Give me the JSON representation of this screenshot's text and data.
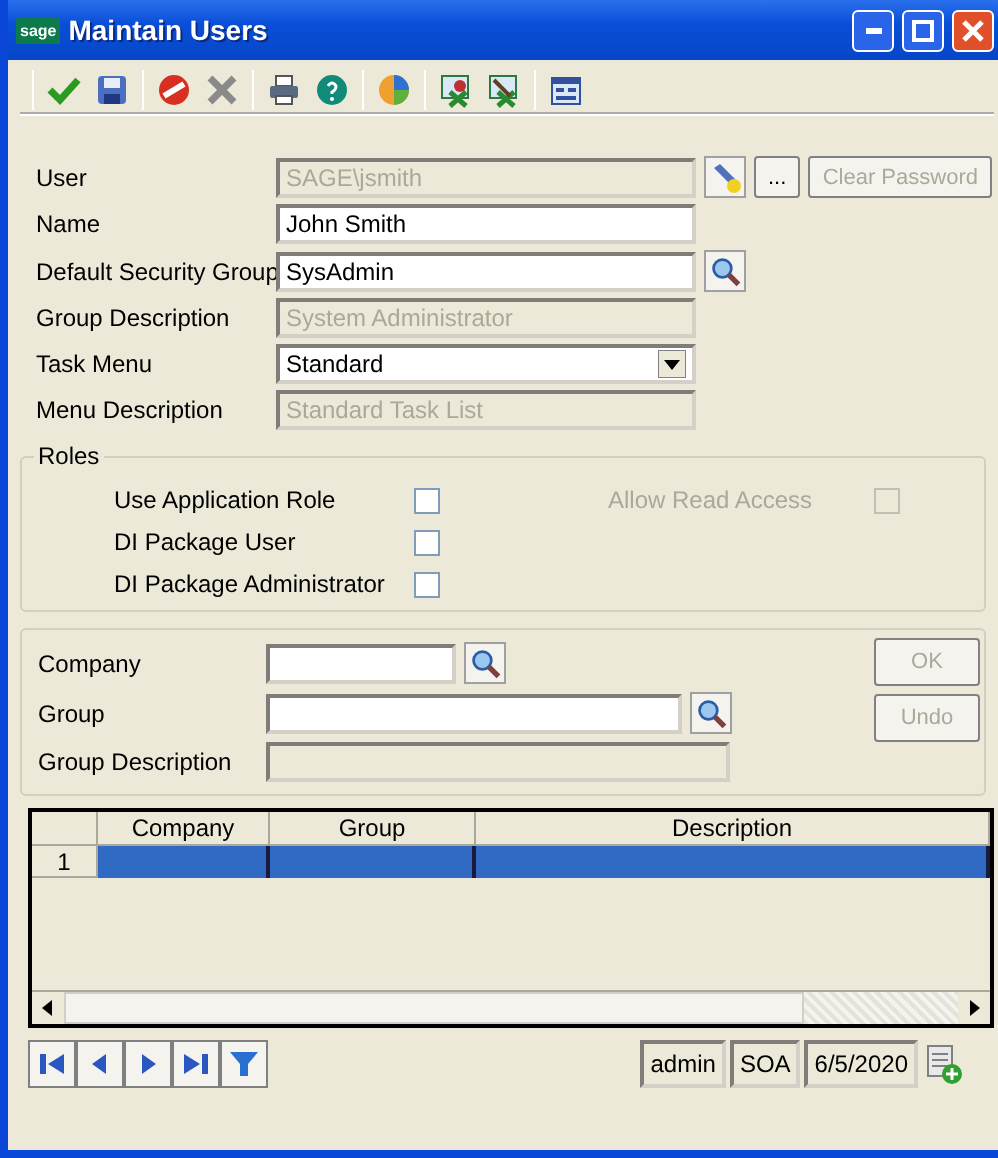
{
  "window": {
    "title": "Maintain Users",
    "logo": "sage"
  },
  "form": {
    "fields": [
      {
        "label": "User",
        "value": "SAGE\\jsmith",
        "disabled": true,
        "kind": "browse",
        "buttons": [
          {
            "label": "...",
            "disabled": false
          },
          {
            "label": "Clear Password",
            "disabled": true
          }
        ]
      },
      {
        "label": "Name",
        "value": "John Smith",
        "disabled": false,
        "kind": "text"
      },
      {
        "label": "Default Security Group",
        "value": "SysAdmin",
        "disabled": false,
        "kind": "search"
      },
      {
        "label": "Group Description",
        "value": "System Administrator",
        "disabled": true,
        "kind": "text"
      },
      {
        "label": "Task Menu",
        "value": "Standard",
        "disabled": false,
        "kind": "combo"
      },
      {
        "label": "Menu Description",
        "value": "Standard Task List",
        "disabled": true,
        "kind": "text"
      }
    ]
  },
  "roles": {
    "title": "Roles",
    "left": [
      {
        "label": "Use Application Role",
        "checked": false,
        "disabled": false
      },
      {
        "label": "DI Package User",
        "checked": false,
        "disabled": false
      },
      {
        "label": "DI Package Administrator",
        "checked": false,
        "disabled": false
      }
    ],
    "right": [
      {
        "label": "Allow Read Access",
        "checked": false,
        "disabled": true
      }
    ]
  },
  "assignment": {
    "fields": [
      {
        "label": "Company",
        "kind": "short-search",
        "disabled": false
      },
      {
        "label": "Group",
        "kind": "search",
        "disabled": false
      },
      {
        "label": "Group Description",
        "kind": "text",
        "disabled": true
      }
    ],
    "buttons": [
      {
        "label": "OK",
        "disabled": true
      },
      {
        "label": "Undo",
        "disabled": true
      }
    ]
  },
  "grid": {
    "columns": [
      "Company",
      "Group",
      "Description"
    ],
    "rows": [
      {
        "number": "1",
        "selected": true
      }
    ]
  },
  "status_bar": [
    "admin",
    "SOA",
    "6/5/2020"
  ]
}
